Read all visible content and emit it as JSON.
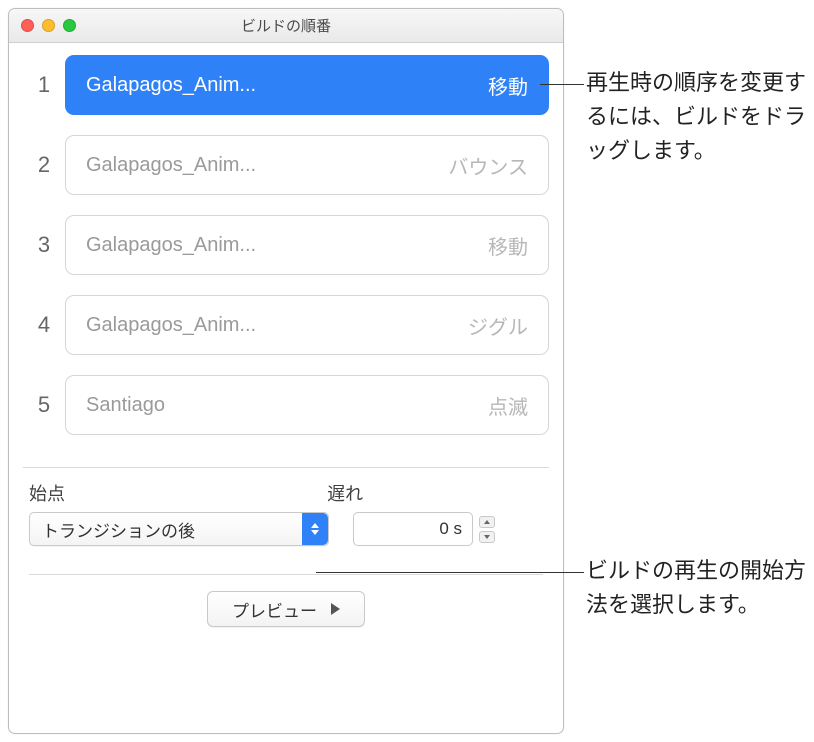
{
  "window": {
    "title": "ビルドの順番"
  },
  "builds": [
    {
      "index": "1",
      "name": "Galapagos_Anim...",
      "effect": "移動",
      "selected": true
    },
    {
      "index": "2",
      "name": "Galapagos_Anim...",
      "effect": "バウンス",
      "selected": false
    },
    {
      "index": "3",
      "name": "Galapagos_Anim...",
      "effect": "移動",
      "selected": false
    },
    {
      "index": "4",
      "name": "Galapagos_Anim...",
      "effect": "ジグル",
      "selected": false
    },
    {
      "index": "5",
      "name": "Santiago",
      "effect": "点滅",
      "selected": false
    }
  ],
  "controls": {
    "start_label": "始点",
    "delay_label": "遅れ",
    "start_value": "トランジションの後",
    "delay_value": "0 s"
  },
  "preview": {
    "label": "プレビュー"
  },
  "callouts": {
    "c1": "再生時の順序を変更するには、ビルドをドラッグします。",
    "c2": "ビルドの再生の開始方法を選択します。"
  }
}
